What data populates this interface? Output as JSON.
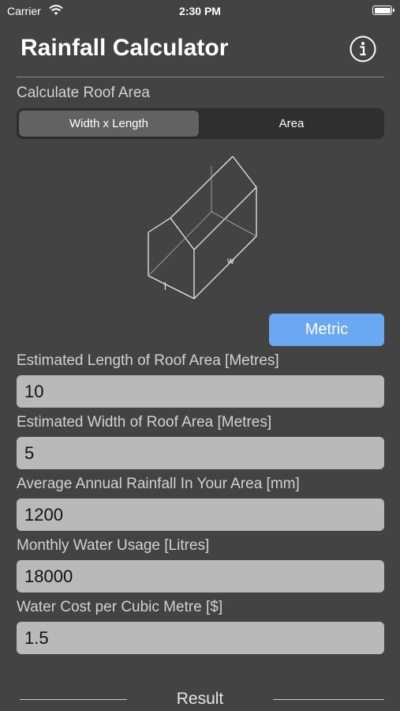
{
  "status_bar": {
    "carrier": "Carrier",
    "time": "2:30 PM"
  },
  "header": {
    "title": "Rainfall Calculator",
    "info_icon": "info-circle-icon"
  },
  "roof_area": {
    "section_label": "Calculate Roof Area",
    "segments": [
      "Width x Length",
      "Area"
    ],
    "selected_segment": "Width x Length",
    "diagram_labels": {
      "length": "l",
      "width": "w"
    }
  },
  "unit_button": {
    "label": "Metric",
    "color": "#6aa9f2"
  },
  "fields": [
    {
      "label": "Estimated Length of Roof Area [Metres]",
      "value": "10"
    },
    {
      "label": "Estimated Width of Roof Area [Metres]",
      "value": "5"
    },
    {
      "label": "Average Annual Rainfall In Your Area [mm]",
      "value": "1200"
    },
    {
      "label": "Monthly Water Usage [Litres]",
      "value": "18000"
    },
    {
      "label": "Water Cost per Cubic Metre [$]",
      "value": "1.5"
    }
  ],
  "result": {
    "label": "Result"
  }
}
